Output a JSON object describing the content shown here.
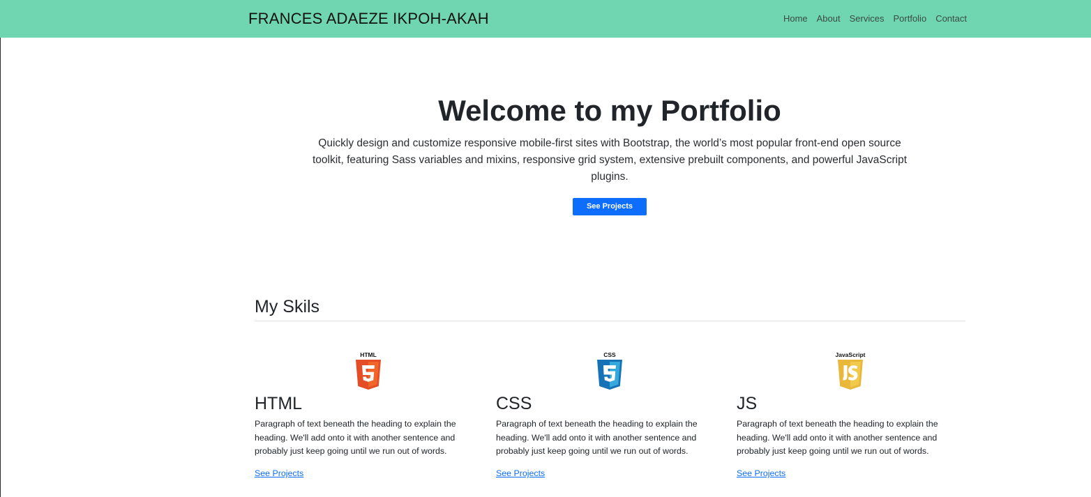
{
  "navbar": {
    "brand": "FRANCES ADAEZE IKPOH-AKAH",
    "links": [
      "Home",
      "About",
      "Services",
      "Portfolio",
      "Contact"
    ],
    "background_color": "#6fd6b1"
  },
  "hero": {
    "title": "Welcome to my Portfolio",
    "description": "Quickly design and customize responsive mobile-first sites with Bootstrap, the world’s most popular front-end open source toolkit, featuring Sass variables and mixins, responsive grid system, extensive prebuilt components, and powerful JavaScript plugins.",
    "button_label": "See Projects",
    "button_color": "#0d6efd"
  },
  "skills": {
    "title": "My Skils",
    "items": [
      {
        "heading": "HTML",
        "logo_label": "HTML",
        "logo_icon": "html5-logo-icon",
        "logo_color": "#e44d26",
        "text": "Paragraph of text beneath the heading to explain the heading. We'll add onto it with another sentence and probably just keep going until we run out of words.",
        "link": "See Projects"
      },
      {
        "heading": "CSS",
        "logo_label": "CSS",
        "logo_icon": "css3-logo-icon",
        "logo_color": "#1572b6",
        "text": "Paragraph of text beneath the heading to explain the heading. We'll add onto it with another sentence and probably just keep going until we run out of words.",
        "link": "See Projects"
      },
      {
        "heading": "JS",
        "logo_label": "JavaScript",
        "logo_icon": "javascript-logo-icon",
        "logo_color": "#e9b83a",
        "text": "Paragraph of text beneath the heading to explain the heading. We'll add onto it with another sentence and probably just keep going until we run out of words.",
        "link": "See Projects"
      }
    ]
  }
}
